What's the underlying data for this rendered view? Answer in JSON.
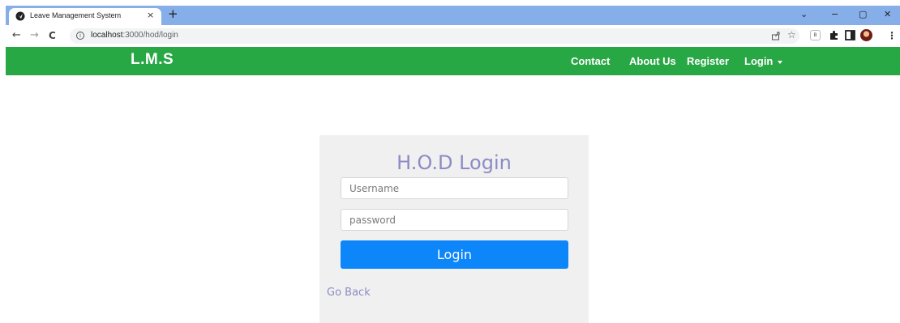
{
  "browser": {
    "tab_title": "Leave Management System",
    "tab_close": "×",
    "new_tab": "+",
    "url_host": "localhost",
    "url_path": ":3000/hod/login",
    "window_controls": [
      "⌄",
      "−",
      "▢",
      "✕"
    ],
    "nav_buttons": [
      "←",
      "→",
      "C"
    ],
    "toolbar_icons": [
      "share-icon",
      "star-icon",
      "extension-badge-icon",
      "puzzle-icon",
      "sidebar-icon",
      "profile-avatar",
      "menu-dots-icon"
    ],
    "extension_badge": "B"
  },
  "navbar": {
    "brand": "L.M.S",
    "links": [
      "Contact",
      "About Us",
      "Register",
      "Login"
    ],
    "background": "#28a745"
  },
  "login_card": {
    "title": "H.O.D Login",
    "username_placeholder": "Username",
    "password_placeholder": "password",
    "button_label": "Login",
    "go_back": "Go Back",
    "accent_color": "#8b8bc6",
    "button_color": "#0d86f9"
  }
}
